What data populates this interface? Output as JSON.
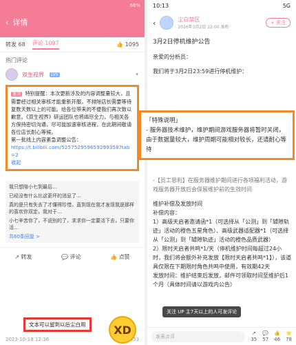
{
  "left": {
    "status": {
      "time": "",
      "battery": "66%"
    },
    "title": "详情",
    "tabs": [
      {
        "label": "转发 68"
      },
      {
        "label": "评论 1097"
      }
    ],
    "likes": "1095",
    "hot_title": "热门评论",
    "user": {
      "name": "双生视界",
      "level": "LV5"
    },
    "comment": {
      "tag": "置顶",
      "text": "特别提醒：本次更新涉及的内容调整量较大，且需要经过相关审核才能重新开服，不排除店长需要等待复数天数以上的可能。给各位带来的不便我们再次致以歉意。《双生视界》研运团队也将竭尽全力，与相关各方保持密切沟通，尽可能加速审核进程，在此期间敬请各位店长耐心等候。",
      "line2": "第一批线上内容紊急调整公告：",
      "link": "https://t.bilibili.com/525752959659299358?tab=2",
      "collapse": "收起"
    },
    "meta": {
      "left": "",
      "right": ""
    },
    "replies": [
      "我只想陪小七到最后…",
      "已经没有什么比这更坏的消息了…",
      "真的是只有失去了才懂得珍惜，直到现在我才发现我是那样的喜欢你双定，我对于…",
      "小七辛苦你了，不说别的了，求求你一定要活下去，只要你活…"
    ],
    "more_replies": "共60条回复 >",
    "actions": {
      "share": "转发",
      "comment": "评论",
      "like": "点赞"
    },
    "callout": "文本可以留到以后尘白用",
    "bottom_meta": {
      "date": "2023-10-18 12:36",
      "likes": "453"
    },
    "emoji": "XD"
  },
  "right": {
    "status": {
      "time": "10:13",
      "signals": "5G"
    },
    "author": "尘白禁区",
    "date": "2026年3月2日 22:00 发布",
    "follow": "+ 关注",
    "title": "3月2日停机维护公告",
    "greeting": "亲爱的分析员：",
    "intro": "我们将于3月2日23:59进行停机维护：",
    "notice": {
      "head": "「特殊说明」",
      "body": "- 服务器技术维护，维护期间游戏服务器将暂时关闭，由于数据量较大，维护周期可能相对较长，还请耐心等待"
    },
    "dim_text": "-【员工恩利】在服务器维护期间进行各项福利活动，游戏服务器开放后会保留维护前的生效时间",
    "compensation": {
      "title": "维护补偿及发放时间",
      "content_label": "补偿内容：",
      "items": [
        "1）高级天启者邀请函*1（可选择从「公测」到「罅隙轨迹」活动的橙色五星角色）、高级武器适配器*1（可选择从「公测」到「罅隙轨迹」活动的橙色品质武器）",
        "2）限时天启者共鸣*1/天（停机维护时间每超过24小时，我们将会额外补充发放【限时天启者共鸣*1】），该道具仅限在下期限时角色共鸣中使用，有效期42天"
      ],
      "time_line": "发放时间：维护结束后发放，邮件可领取时间至维护后1个月（具体时间请以游戏内公告）"
    },
    "toast": "关注 UP 主7天以上的人可发评论",
    "bottom": {
      "input": "发表点评",
      "stats": [
        "35",
        "57",
        "46",
        "78"
      ]
    }
  }
}
